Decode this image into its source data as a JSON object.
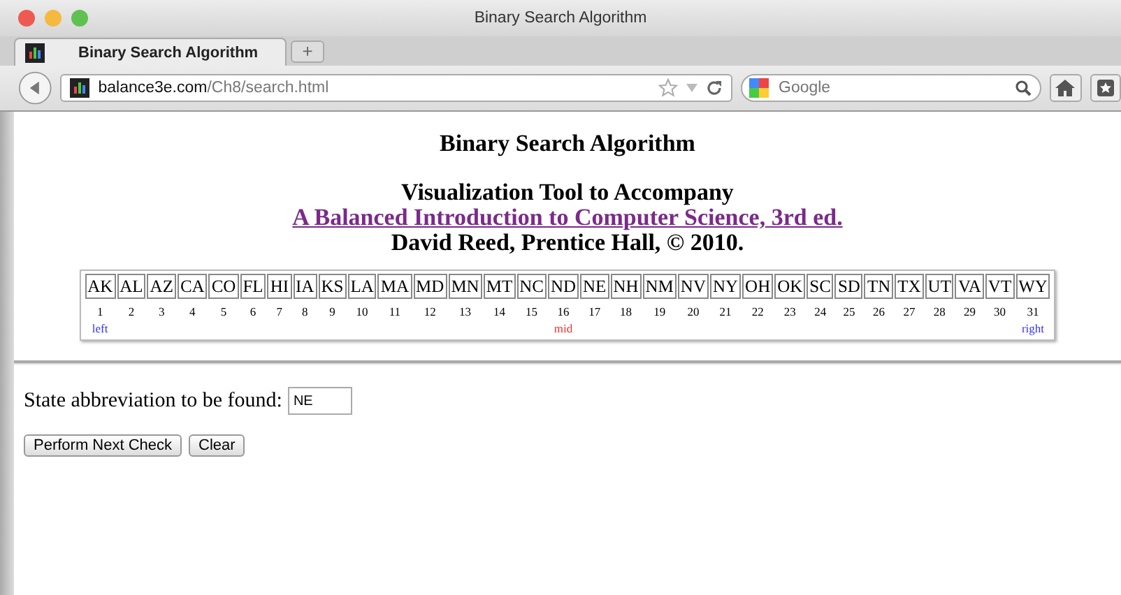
{
  "window": {
    "title": "Binary Search Algorithm"
  },
  "tabs": [
    {
      "label": "Binary Search Algorithm",
      "selected": true
    }
  ],
  "new_tab": "+",
  "address": {
    "domain": "balance3e.com",
    "path": "/Ch8/search.html"
  },
  "search": {
    "placeholder": "Google"
  },
  "page": {
    "heading": "Binary Search Algorithm",
    "subtitle": "Visualization Tool to Accompany",
    "link": "A Balanced Introduction to Computer Science, 3rd ed.",
    "author": "David Reed, Prentice Hall, © 2010.",
    "cells": [
      {
        "abbr": "AK",
        "index": "1",
        "marker": {
          "text": "left",
          "kind": "left"
        }
      },
      {
        "abbr": "AL",
        "index": "2"
      },
      {
        "abbr": "AZ",
        "index": "3"
      },
      {
        "abbr": "CA",
        "index": "4"
      },
      {
        "abbr": "CO",
        "index": "5"
      },
      {
        "abbr": "FL",
        "index": "6"
      },
      {
        "abbr": "HI",
        "index": "7"
      },
      {
        "abbr": "IA",
        "index": "8"
      },
      {
        "abbr": "KS",
        "index": "9"
      },
      {
        "abbr": "LA",
        "index": "10"
      },
      {
        "abbr": "MA",
        "index": "11"
      },
      {
        "abbr": "MD",
        "index": "12"
      },
      {
        "abbr": "MN",
        "index": "13"
      },
      {
        "abbr": "MT",
        "index": "14"
      },
      {
        "abbr": "NC",
        "index": "15"
      },
      {
        "abbr": "ND",
        "index": "16",
        "marker": {
          "text": "mid",
          "kind": "mid"
        }
      },
      {
        "abbr": "NE",
        "index": "17"
      },
      {
        "abbr": "NH",
        "index": "18"
      },
      {
        "abbr": "NM",
        "index": "19"
      },
      {
        "abbr": "NV",
        "index": "20"
      },
      {
        "abbr": "NY",
        "index": "21"
      },
      {
        "abbr": "OH",
        "index": "22"
      },
      {
        "abbr": "OK",
        "index": "23"
      },
      {
        "abbr": "SC",
        "index": "24"
      },
      {
        "abbr": "SD",
        "index": "25"
      },
      {
        "abbr": "TN",
        "index": "26"
      },
      {
        "abbr": "TX",
        "index": "27"
      },
      {
        "abbr": "UT",
        "index": "28"
      },
      {
        "abbr": "VA",
        "index": "29"
      },
      {
        "abbr": "VT",
        "index": "30"
      },
      {
        "abbr": "WY",
        "index": "31",
        "marker": {
          "text": "right",
          "kind": "right"
        }
      }
    ],
    "prompt": "State abbreviation to be found:",
    "value": "NE",
    "buttons": [
      "Perform Next Check",
      "Clear"
    ]
  }
}
